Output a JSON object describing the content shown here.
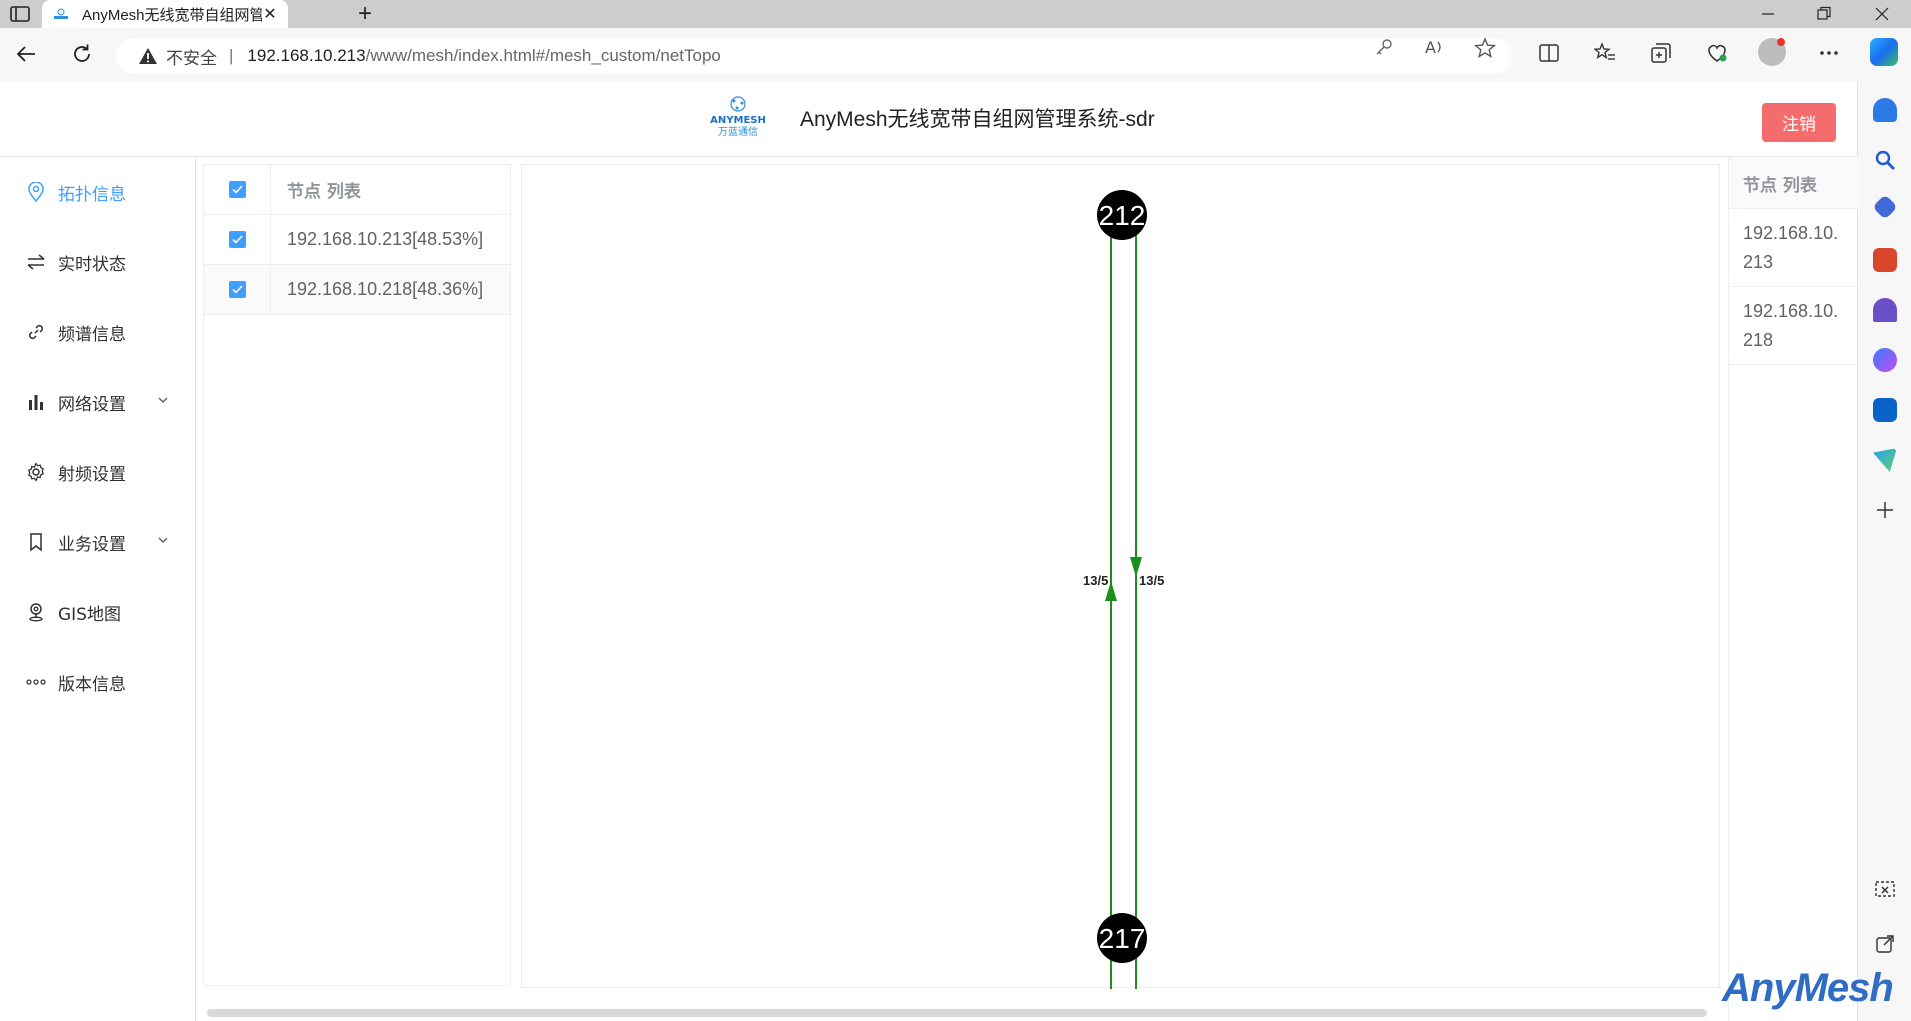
{
  "browser": {
    "tab_title": "AnyMesh无线宽带自组网管理系统",
    "tab_close": "✕",
    "new_tab": "+",
    "security_label": "不安全",
    "separator": "|",
    "url_host": "192.168.10.213",
    "url_path": "/www/mesh/index.html#/mesh_custom/netTopo"
  },
  "header": {
    "logo_text": "ANYMESH",
    "logo_sub": "万蓝通信",
    "title": "AnyMesh无线宽带自组网管理系统-sdr",
    "logout_label": "注销"
  },
  "nav": {
    "items": [
      {
        "label": "拓扑信息",
        "icon": "location-pin-icon",
        "active": true
      },
      {
        "label": "实时状态",
        "icon": "swap-arrows-icon"
      },
      {
        "label": "频谱信息",
        "icon": "link-icon"
      },
      {
        "label": "网络设置",
        "icon": "bar-chart-icon",
        "expandable": true
      },
      {
        "label": "射频设置",
        "icon": "gear-icon"
      },
      {
        "label": "业务设置",
        "icon": "bookmark-icon",
        "expandable": true
      },
      {
        "label": "GIS地图",
        "icon": "map-pin-icon"
      },
      {
        "label": "版本信息",
        "icon": "more-dots-icon"
      }
    ]
  },
  "node_table": {
    "header": "节点 列表",
    "rows": [
      {
        "label": "192.168.10.213[48.53%]",
        "checked": true
      },
      {
        "label": "192.168.10.218[48.36%]",
        "checked": true
      }
    ]
  },
  "topology": {
    "nodes": [
      {
        "id": "212"
      },
      {
        "id": "217"
      }
    ],
    "links": [
      {
        "from": "217",
        "to": "212",
        "label": "13/5"
      },
      {
        "from": "212",
        "to": "217",
        "label": "13/5"
      }
    ],
    "link_color": "#1a8f1a",
    "node_color": "#000000"
  },
  "right_list": {
    "header": "节点 列表",
    "items": [
      {
        "line1": "192.168.10.",
        "line2": "213"
      },
      {
        "line1": "192.168.10.",
        "line2": "218"
      }
    ]
  },
  "watermark": "AnyMesh",
  "colors": {
    "accent": "#409eff",
    "danger": "#f56c6c"
  }
}
